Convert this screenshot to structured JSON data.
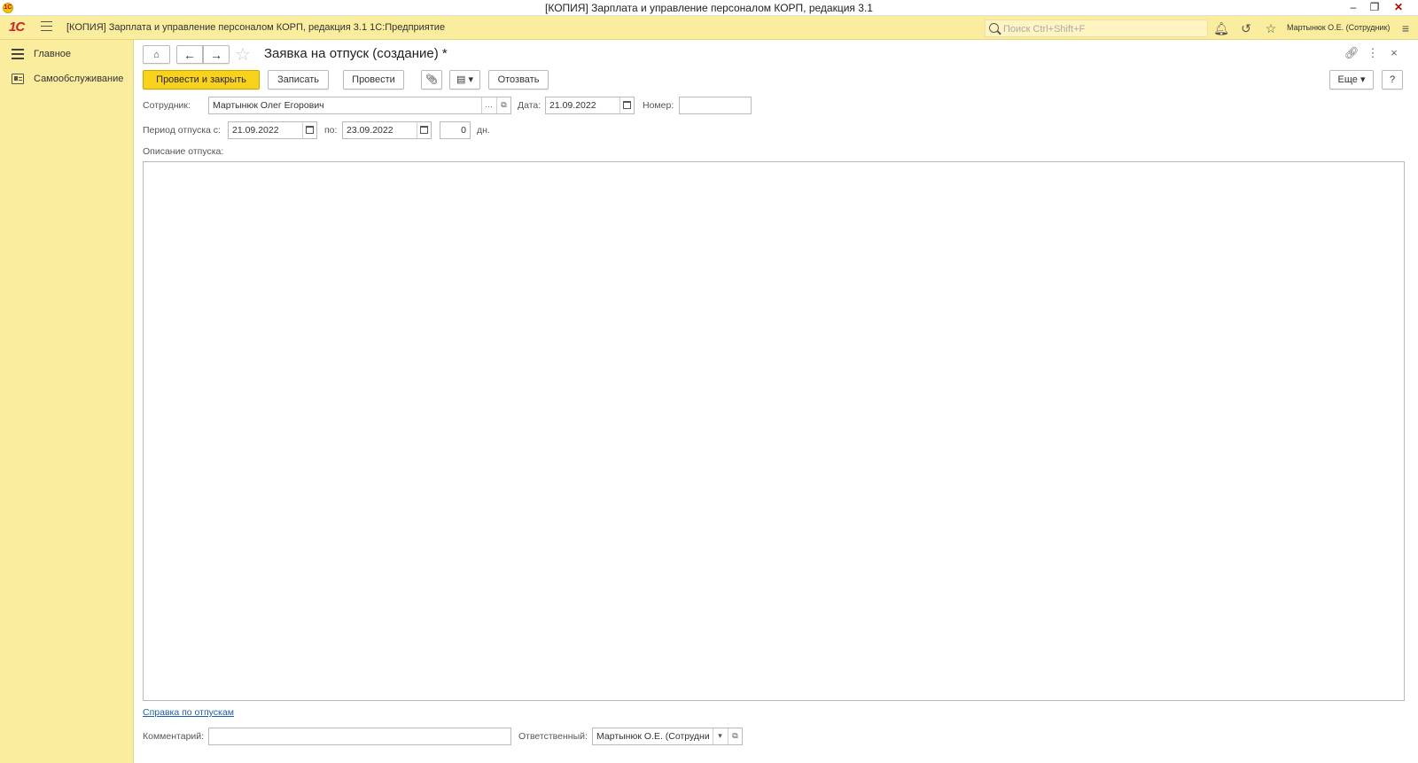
{
  "window": {
    "title": "[КОПИЯ] Зарплата и управление персоналом КОРП, редакция 3.1",
    "logo_text": "1C"
  },
  "header": {
    "logo": "1С",
    "app_title": "[КОПИЯ] Зарплата и управление персоналом КОРП, редакция 3.1 1С:Предприятие",
    "search_placeholder": "Поиск Ctrl+Shift+F",
    "user": "Мартынюк О.Е. (Сотрудник)"
  },
  "sidebar": {
    "items": [
      {
        "label": "Главное",
        "icon": "menu-icon"
      },
      {
        "label": "Самообслуживание",
        "icon": "id-card-icon"
      }
    ]
  },
  "form": {
    "title": "Заявка на отпуск (создание) *",
    "toolbar": {
      "post_and_close": "Провести и закрыть",
      "save": "Записать",
      "post": "Провести",
      "revoke": "Отозвать",
      "more": "Еще",
      "help": "?"
    },
    "employee": {
      "label": "Сотрудник:",
      "value": "Мартынюк Олег Егорович"
    },
    "date": {
      "label": "Дата:",
      "value": "21.09.2022"
    },
    "number": {
      "label": "Номер:",
      "value": ""
    },
    "period": {
      "label_from": "Период отпуска с:",
      "from": "21.09.2022",
      "label_to": "по:",
      "to": "23.09.2022",
      "days": "0",
      "days_unit": "дн."
    },
    "description": {
      "label": "Описание отпуска:",
      "value": ""
    },
    "vacation_help_link": "Справка по отпускам",
    "comment": {
      "label": "Комментарий:",
      "value": ""
    },
    "responsible": {
      "label": "Ответственный:",
      "value": "Мартынюк О.Е. (Сотрудни"
    }
  }
}
